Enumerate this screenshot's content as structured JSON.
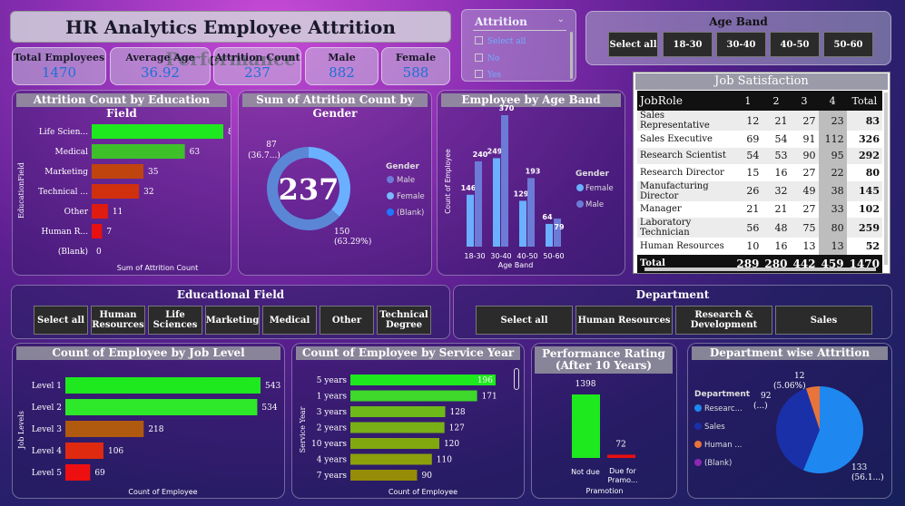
{
  "title": "HR Analytics Employee Attrition Performance",
  "kpis": [
    {
      "label": "Total Employees",
      "value": "1470"
    },
    {
      "label": "Average Age",
      "value": "36.92"
    },
    {
      "label": "Attrition Count",
      "value": "237"
    },
    {
      "label": "Male",
      "value": "882"
    },
    {
      "label": "Female",
      "value": "588"
    }
  ],
  "attrition_slicer": {
    "title": "Attrition",
    "items": [
      "Select all",
      "No",
      "Yes"
    ]
  },
  "age_band_slicer": {
    "title": "Age Band",
    "items": [
      "Select all",
      "18-30",
      "30-40",
      "40-50",
      "50-60"
    ]
  },
  "education_slicer": {
    "title": "Educational Field",
    "items": [
      "Select all",
      "Human Resources",
      "Life Sciences",
      "Marketing",
      "Medical",
      "Other",
      "Technical Degree"
    ]
  },
  "department_slicer": {
    "title": "Department",
    "items": [
      "Select all",
      "Human Resources",
      "Research & Development",
      "Sales"
    ]
  },
  "job_satisfaction": {
    "title": "Job Satisfaction",
    "headers": [
      "JobRole",
      "1",
      "2",
      "3",
      "4",
      "Total"
    ],
    "rows": [
      [
        "Sales Representative",
        "12",
        "21",
        "27",
        "23",
        "83"
      ],
      [
        "Sales Executive",
        "69",
        "54",
        "91",
        "112",
        "326"
      ],
      [
        "Research Scientist",
        "54",
        "53",
        "90",
        "95",
        "292"
      ],
      [
        "Research Director",
        "15",
        "16",
        "27",
        "22",
        "80"
      ],
      [
        "Manufacturing Director",
        "26",
        "32",
        "49",
        "38",
        "145"
      ],
      [
        "Manager",
        "21",
        "21",
        "27",
        "33",
        "102"
      ],
      [
        "Laboratory Technician",
        "56",
        "48",
        "75",
        "80",
        "259"
      ],
      [
        "Human Resources",
        "10",
        "16",
        "13",
        "13",
        "52"
      ]
    ],
    "total": [
      "Total",
      "289",
      "280",
      "442",
      "459",
      "1470"
    ]
  },
  "chart_data": [
    {
      "id": "edu",
      "type": "bar",
      "title": "Attrition Count by Education Field",
      "ylabel": "EducationField",
      "xlabel": "Sum of Attrition Count",
      "categories": [
        "Life Scien...",
        "Medical",
        "Marketing",
        "Technical ...",
        "Other",
        "Human R...",
        "(Blank)"
      ],
      "values": [
        89,
        63,
        35,
        32,
        11,
        7,
        0
      ],
      "colors": [
        "#1ee81e",
        "#3ec02a",
        "#c0440e",
        "#d0300e",
        "#e01c10",
        "#e81010",
        "#e81010"
      ]
    },
    {
      "id": "gender",
      "type": "pie",
      "title": "Sum of Attrition Count by Gender",
      "center_label": "237",
      "legend_title": "Gender",
      "legend": [
        "Male",
        "Female",
        "(Blank)"
      ],
      "slices": [
        {
          "name": "Male",
          "value": 150,
          "label": "150",
          "pct": "(63.29%)",
          "color": "#5b86d6"
        },
        {
          "name": "Female",
          "value": 87,
          "label": "87",
          "pct": "(36.7...)",
          "color": "#6ab0ff"
        }
      ],
      "legend_colors": [
        "#6c7bd6",
        "#7ab8ff",
        "#1e78ff"
      ]
    },
    {
      "id": "ageband",
      "type": "bar",
      "title": "Employee by Age Band",
      "xlabel": "Age Band",
      "ylabel": "Count of Employee",
      "legend_title": "Gender",
      "categories": [
        "18-30",
        "30-40",
        "40-50",
        "50-60"
      ],
      "series": [
        {
          "name": "Female",
          "values": [
            146,
            249,
            129,
            64
          ],
          "color": "#6ab0ff"
        },
        {
          "name": "Male",
          "values": [
            240,
            370,
            193,
            79
          ],
          "color": "#6c7bd6"
        }
      ]
    },
    {
      "id": "joblevel",
      "type": "bar",
      "title": "Count of Employee by Job Level",
      "xlabel": "Count of Employee",
      "ylabel": "Job Levels",
      "categories": [
        "Level 1",
        "Level 2",
        "Level 3",
        "Level 4",
        "Level 5"
      ],
      "values": [
        543,
        534,
        218,
        106,
        69
      ],
      "colors": [
        "#1ee81e",
        "#2ee82a",
        "#b05a10",
        "#e02a10",
        "#ee1010"
      ]
    },
    {
      "id": "service",
      "type": "bar",
      "title": "Count of Employee by Service Year",
      "xlabel": "Count of Employee",
      "ylabel": "Service Year",
      "categories": [
        "5 years",
        "1 years",
        "3 years",
        "2 years",
        "10 years",
        "4 years",
        "7 years"
      ],
      "values": [
        196,
        171,
        128,
        127,
        120,
        110,
        90
      ],
      "colors": [
        "#1ee81e",
        "#3ed82a",
        "#6eb81a",
        "#78b016",
        "#82a810",
        "#8ca00c",
        "#968c08"
      ]
    },
    {
      "id": "perf",
      "type": "bar",
      "title": "Performance Rating (After 10 Years)",
      "xlabel": "Pramotion",
      "categories": [
        "Not due",
        "Due for Pramo..."
      ],
      "values": [
        1398,
        72
      ],
      "colors": [
        "#1ee81e",
        "#e81010"
      ]
    },
    {
      "id": "dept",
      "type": "pie",
      "title": "Department wise Attrition",
      "legend_title": "Department",
      "legend": [
        "Researc...",
        "Sales",
        "Human ...",
        "(Blank)"
      ],
      "legend_colors": [
        "#1e88f0",
        "#1a30a8",
        "#e8743a",
        "#8a2ab0"
      ],
      "slices": [
        {
          "name": "Research & Development",
          "value": 133,
          "label": "133",
          "pct": "(56.1...)",
          "color": "#1e88f0"
        },
        {
          "name": "Sales",
          "value": 92,
          "label": "92",
          "pct": "(...)",
          "color": "#1a30a8"
        },
        {
          "name": "Human Resources",
          "value": 12,
          "label": "12",
          "pct": "(5.06%)",
          "color": "#e8743a"
        }
      ]
    }
  ]
}
